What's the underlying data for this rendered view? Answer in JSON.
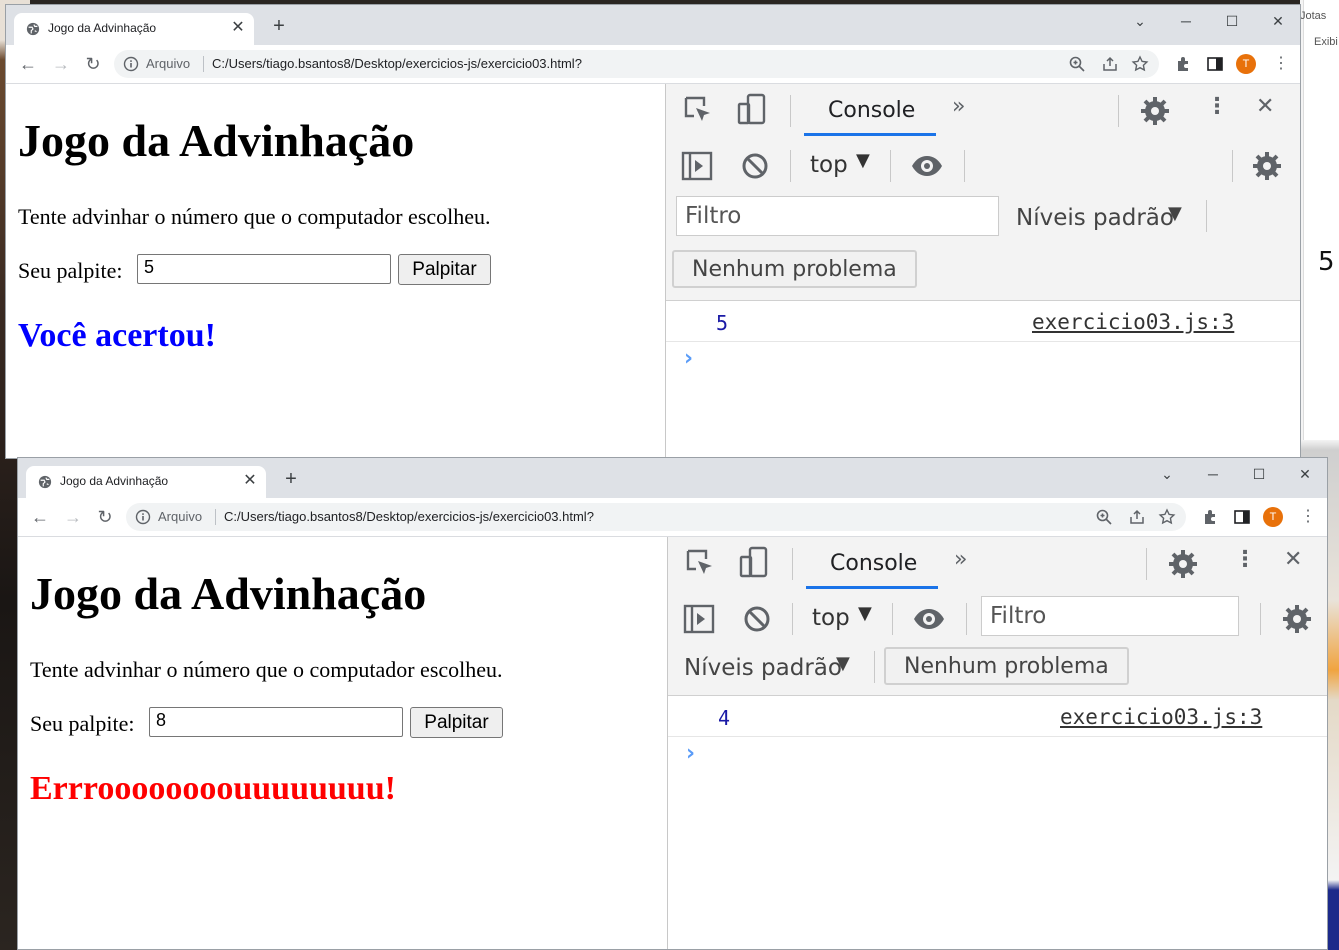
{
  "background": {
    "right_panel_labels": [
      "Jotas",
      "Exibi"
    ],
    "right_side_value": "5"
  },
  "windows": [
    {
      "tab_title": "Jogo da Advinhação",
      "address_scheme": "Arquivo",
      "address_url": "C:/Users/tiago.bsantos8/Desktop/exercicios-js/exercicio03.html?",
      "profile_initial": "T",
      "page": {
        "heading": "Jogo da Advinhação",
        "instruction": "Tente advinhar o número que o computador escolheu.",
        "guess_label": "Seu palpite:",
        "guess_value": "5",
        "guess_button": "Palpitar",
        "result_text": "Você acertou!",
        "result_color": "#0000ff"
      },
      "devtools": {
        "active_tab": "Console",
        "context": "top",
        "filter_placeholder": "Filtro",
        "levels": "Níveis padrão",
        "issues": "Nenhum problema",
        "log_value": "5",
        "log_source": "exercicio03.js:3",
        "prompt": "›"
      }
    },
    {
      "tab_title": "Jogo da Advinhação",
      "address_scheme": "Arquivo",
      "address_url": "C:/Users/tiago.bsantos8/Desktop/exercicios-js/exercicio03.html?",
      "profile_initial": "T",
      "page": {
        "heading": "Jogo da Advinhação",
        "instruction": "Tente advinhar o número que o computador escolheu.",
        "guess_label": "Seu palpite:",
        "guess_value": "8",
        "guess_button": "Palpitar",
        "result_text": "Errroooooooouuuuuuuu!",
        "result_color": "#ff0000"
      },
      "devtools": {
        "active_tab": "Console",
        "context": "top",
        "filter_placeholder": "Filtro",
        "levels": "Níveis padrão",
        "issues": "Nenhum problema",
        "log_value": "4",
        "log_source": "exercicio03.js:3",
        "prompt": "›"
      }
    }
  ]
}
